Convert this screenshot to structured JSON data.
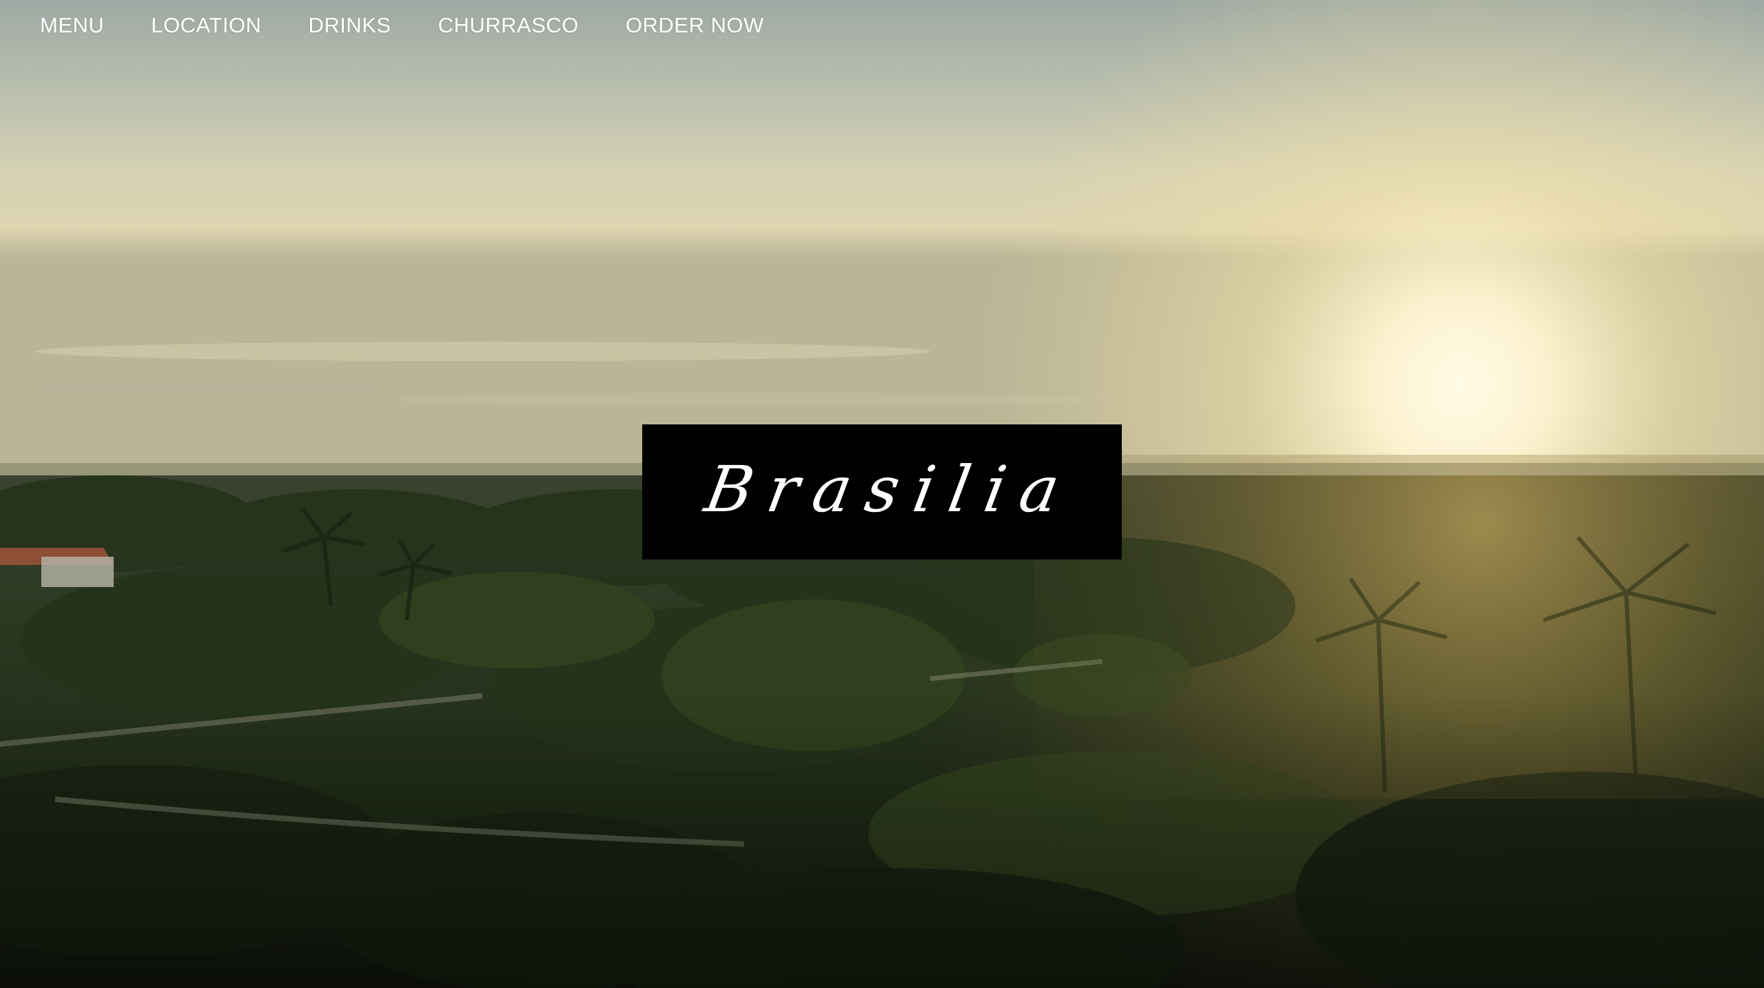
{
  "nav": {
    "items": [
      {
        "label": "MENU"
      },
      {
        "label": "LOCATION"
      },
      {
        "label": "DRINKS"
      },
      {
        "label": "CHURRASCO"
      },
      {
        "label": "ORDER NOW"
      }
    ]
  },
  "hero": {
    "logo_text": "Brasilia"
  },
  "colors": {
    "nav_text": "#ffffff",
    "logo_background": "#000000",
    "logo_text": "#ffffff",
    "sky_top": "#9fa9a3",
    "sun_glow": "#fff6d6",
    "foliage": "#2b3620"
  }
}
